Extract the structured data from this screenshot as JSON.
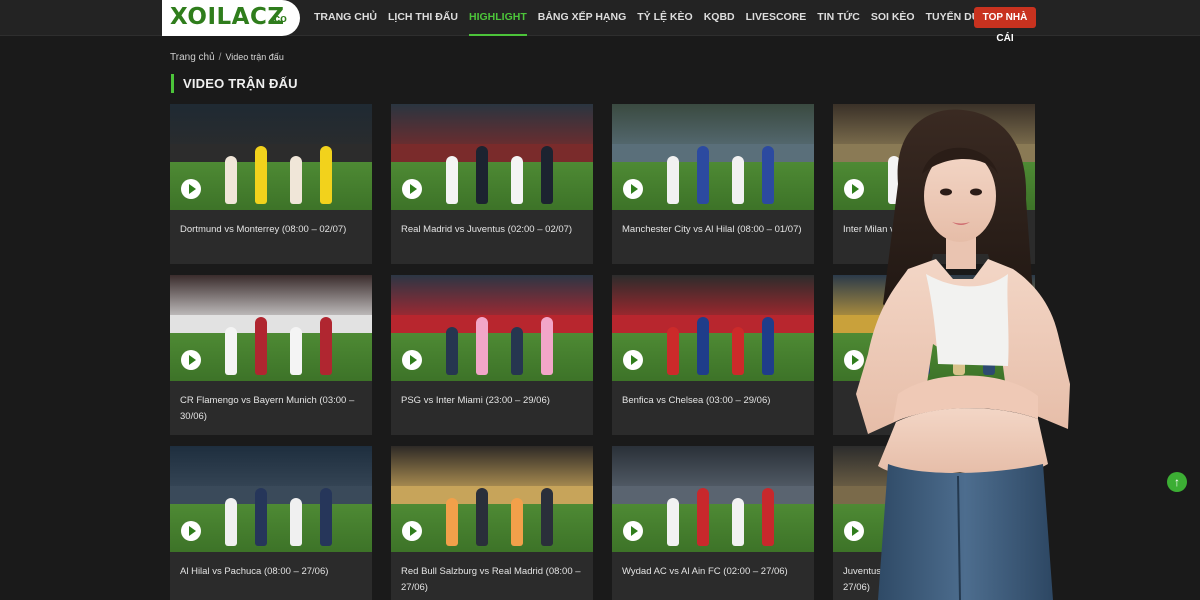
{
  "header": {
    "logo": "XOILACZ",
    "logo_suffix": ".co",
    "nav": [
      {
        "label": "TRANG CHỦ",
        "active": false
      },
      {
        "label": "LỊCH THI ĐẤU",
        "active": false
      },
      {
        "label": "HIGHLIGHT",
        "active": true
      },
      {
        "label": "BẢNG XẾP HẠNG",
        "active": false
      },
      {
        "label": "TỶ LỆ KÈO",
        "active": false
      },
      {
        "label": "KQBD",
        "active": false
      },
      {
        "label": "LIVESCORE",
        "active": false
      },
      {
        "label": "TIN TỨC",
        "active": false
      },
      {
        "label": "SOI KÈO",
        "active": false
      },
      {
        "label": "TUYỂN DỤNG",
        "active": false
      }
    ],
    "top_button": "TOP NHÀ CÁI"
  },
  "breadcrumb": {
    "home": "Trang chủ",
    "separator": "/",
    "current": "Video trận đấu"
  },
  "page_title": "VIDEO TRẬN ĐẤU",
  "videos": [
    {
      "caption": "Dortmund vs Monterrey (08:00 – 02/07)",
      "icon": "play-icon"
    },
    {
      "caption": "Real Madrid vs Juventus (02:00 – 02/07)",
      "icon": "play-icon"
    },
    {
      "caption": "Manchester City vs Al Hilal (08:00 – 01/07)",
      "icon": "play-icon"
    },
    {
      "caption": "Inter Milan vs Fluminense (02:00 – 01/07)",
      "icon": "play-icon"
    },
    {
      "caption": "CR Flamengo vs Bayern Munich (03:00 – 30/06)",
      "icon": "play-icon"
    },
    {
      "caption": "PSG vs Inter Miami (23:00 – 29/06)",
      "icon": "play-icon"
    },
    {
      "caption": "Benfica vs Chelsea (03:00 – 29/06)",
      "icon": "play-icon"
    },
    {
      "caption": "",
      "icon": "play-icon"
    },
    {
      "caption": "Al Hilal vs Pachuca (08:00 – 27/06)",
      "icon": "play-icon"
    },
    {
      "caption": "Red Bull Salzburg vs Real Madrid (08:00 – 27/06)",
      "icon": "play-icon"
    },
    {
      "caption": "Wydad AC vs Al Ain FC (02:00 – 27/06)",
      "icon": "play-icon"
    },
    {
      "caption": "Juventus vs Manchester City (08:00 – 27/06)",
      "icon": "play-icon"
    }
  ],
  "scroll_top_icon": "arrow-up-icon",
  "colors": {
    "accent": "#4cc43a",
    "brand": "#2f7d1c",
    "cta": "#c8321f",
    "background": "#1a1a1a",
    "card": "#2b2b2b"
  }
}
